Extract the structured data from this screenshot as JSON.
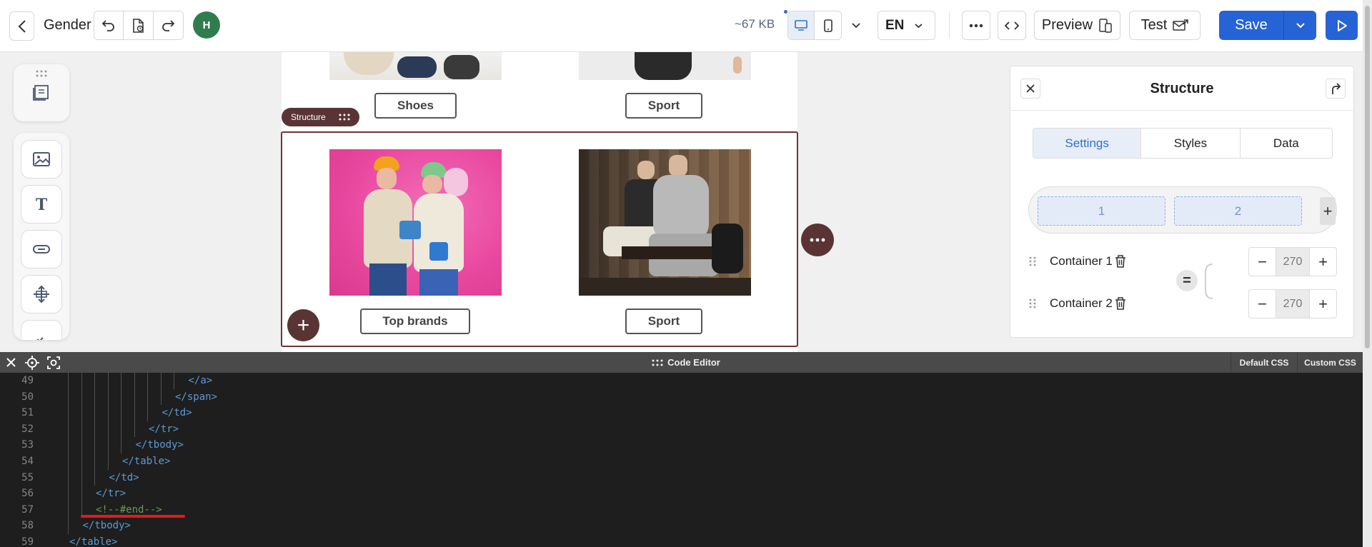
{
  "topbar": {
    "title": "Gender",
    "avatar_initial": "H",
    "size_label": "~67 KB",
    "lang": "EN",
    "preview_label": "Preview",
    "test_label": "Test",
    "save_label": "Save"
  },
  "canvas": {
    "top_row": [
      {
        "button_label": "Shoes"
      },
      {
        "button_label": "Sport"
      }
    ],
    "structure_tag": "Structure",
    "selected_row": [
      {
        "button_label": "Top brands"
      },
      {
        "button_label": "Sport"
      }
    ],
    "add_symbol": "+"
  },
  "panel": {
    "title": "Structure",
    "tabs": [
      {
        "label": "Settings",
        "active": true
      },
      {
        "label": "Styles",
        "active": false
      },
      {
        "label": "Data",
        "active": false
      }
    ],
    "columns": [
      "1",
      "2"
    ],
    "add_column": "+",
    "containers": [
      {
        "label": "Container 1",
        "value": "270"
      },
      {
        "label": "Container 2",
        "value": "270"
      }
    ],
    "link_symbol": "="
  },
  "editor": {
    "title": "Code Editor",
    "tabs": [
      "Default CSS",
      "Custom CSS"
    ],
    "lines": [
      {
        "n": "49",
        "text": "</a>",
        "indent": 9,
        "comment": false
      },
      {
        "n": "50",
        "text": "</span>",
        "indent": 8,
        "comment": false
      },
      {
        "n": "51",
        "text": "</td>",
        "indent": 7,
        "comment": false
      },
      {
        "n": "52",
        "text": "</tr>",
        "indent": 6,
        "comment": false
      },
      {
        "n": "53",
        "text": "</tbody>",
        "indent": 5,
        "comment": false
      },
      {
        "n": "54",
        "text": "</table>",
        "indent": 4,
        "comment": false
      },
      {
        "n": "55",
        "text": "</td>",
        "indent": 3,
        "comment": false
      },
      {
        "n": "56",
        "text": "</tr>",
        "indent": 2,
        "comment": false
      },
      {
        "n": "57",
        "text": "<!--#end-->",
        "indent": 2,
        "comment": true
      },
      {
        "n": "58",
        "text": "</tbody>",
        "indent": 1,
        "comment": false
      },
      {
        "n": "59",
        "text": "</table>",
        "indent": 0,
        "comment": false
      }
    ]
  },
  "colors": {
    "accent": "#2563d6",
    "brand_dark": "#5a3434",
    "avatar": "#2f7d4f",
    "code_tag": "#5b9bd5",
    "code_comment": "#6a9955",
    "highlight": "#e01b1b"
  }
}
